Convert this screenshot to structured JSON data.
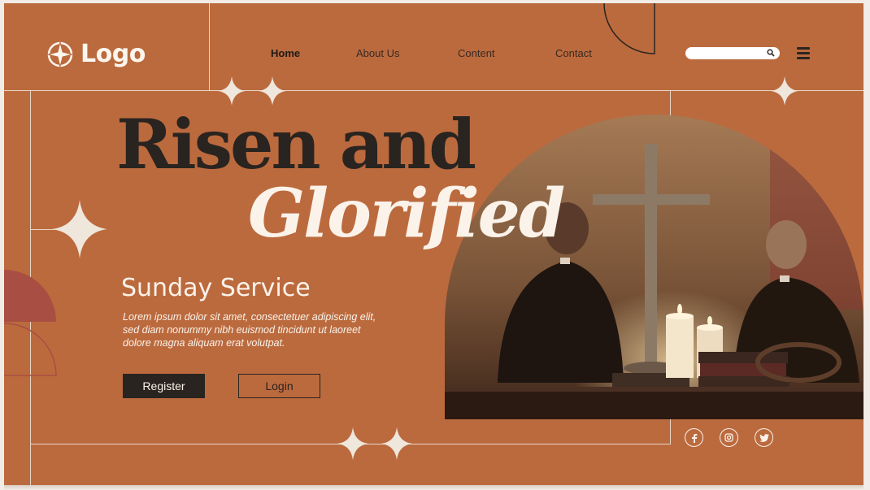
{
  "brand": {
    "logo_text": "Logo"
  },
  "nav": {
    "items": [
      {
        "label": "Home",
        "active": true
      },
      {
        "label": "About Us",
        "active": false
      },
      {
        "label": "Content",
        "active": false
      },
      {
        "label": "Contact",
        "active": false
      }
    ]
  },
  "search": {
    "placeholder": ""
  },
  "hero": {
    "headline_line1": "Risen and",
    "headline_line2": "Glorified",
    "subtitle": "Sunday Service",
    "body": "Lorem ipsum dolor sit amet, consectetuer adipiscing elit, sed diam nonummy nibh euismod tincidunt ut laoreet dolore magna aliquam erat volutpat.",
    "register_label": "Register",
    "login_label": "Login"
  },
  "social": [
    "facebook-icon",
    "instagram-icon",
    "twitter-icon"
  ],
  "colors": {
    "background": "#bb6a3e",
    "dark": "#2a2420",
    "cream": "#fbf3ea",
    "accent": "#a94e42"
  }
}
